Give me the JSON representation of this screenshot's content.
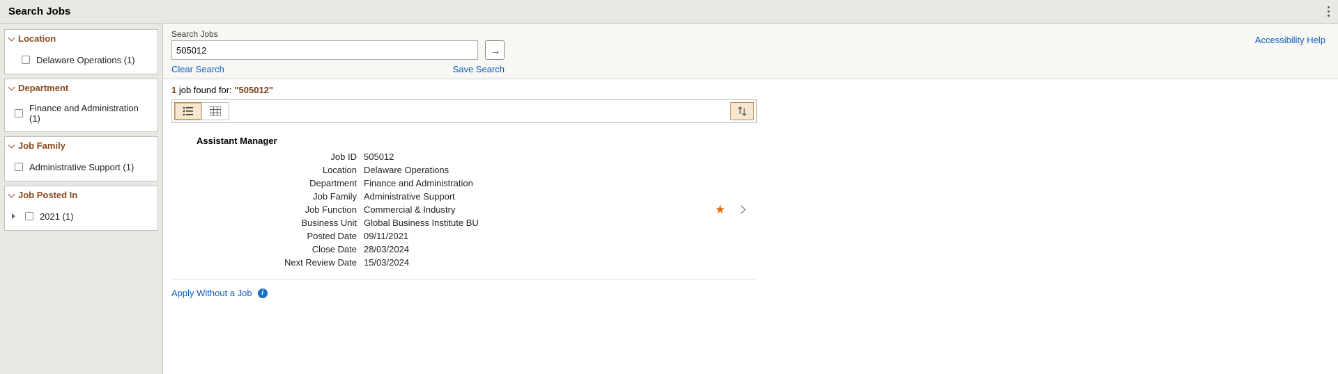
{
  "header": {
    "title": "Search Jobs"
  },
  "accessibility_label": "Accessibility Help",
  "search": {
    "label": "Search Jobs",
    "value": "505012",
    "clear_label": "Clear Search",
    "save_label": "Save Search"
  },
  "facets": {
    "location": {
      "title": "Location",
      "items": [
        {
          "label": "Delaware Operations (1)"
        }
      ]
    },
    "department": {
      "title": "Department",
      "items": [
        {
          "label": "Finance and Administration (1)"
        }
      ]
    },
    "job_family": {
      "title": "Job Family",
      "items": [
        {
          "label": "Administrative Support (1)"
        }
      ]
    },
    "posted": {
      "title": "Job Posted In",
      "items": [
        {
          "label": "2021 (1)"
        }
      ]
    }
  },
  "results": {
    "count": "1",
    "count_suffix": " job found for: ",
    "term": "\"505012\""
  },
  "job": {
    "title": "Assistant Manager",
    "fields": [
      {
        "label": "Job ID",
        "value": "505012"
      },
      {
        "label": "Location",
        "value": "Delaware Operations"
      },
      {
        "label": "Department",
        "value": "Finance and Administration"
      },
      {
        "label": "Job Family",
        "value": "Administrative Support"
      },
      {
        "label": "Job Function",
        "value": "Commercial & Industry"
      },
      {
        "label": "Business Unit",
        "value": "Global Business Institute BU"
      },
      {
        "label": "Posted Date",
        "value": "09/11/2021"
      },
      {
        "label": "Close Date",
        "value": "28/03/2024"
      },
      {
        "label": "Next Review Date",
        "value": "15/03/2024"
      }
    ]
  },
  "apply_label": "Apply Without a Job"
}
